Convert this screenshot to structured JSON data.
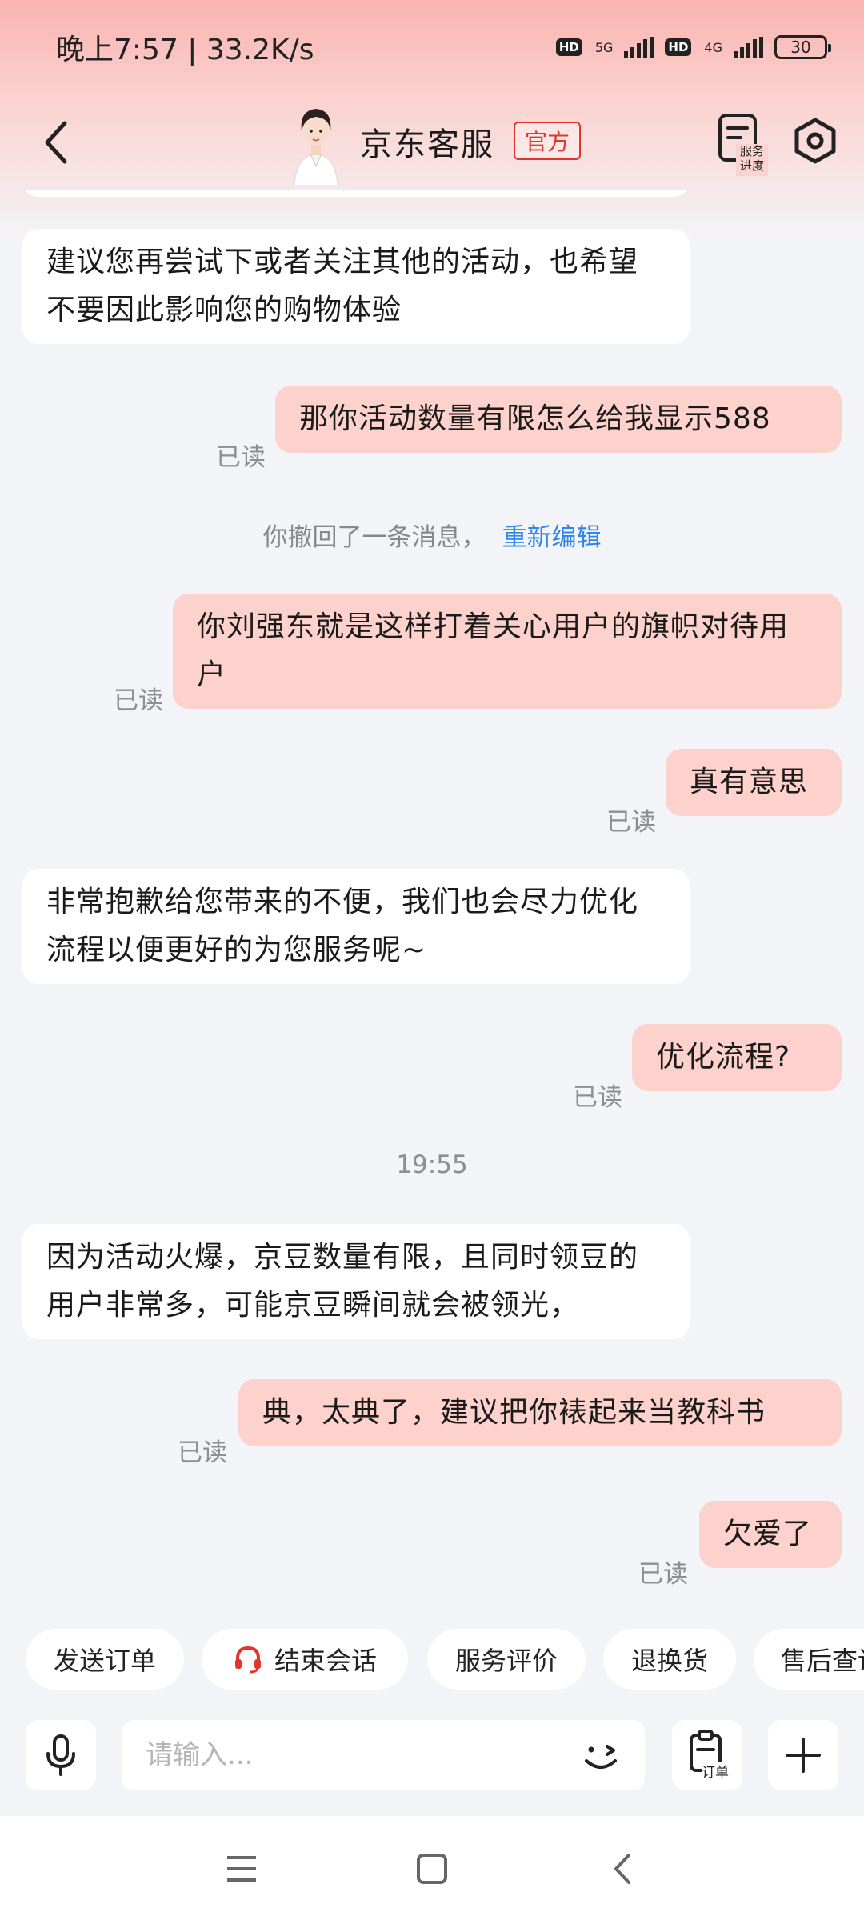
{
  "status_bar": {
    "time_speed": "晚上7:57 | 33.2K/s",
    "hd1": "HD",
    "net1": "5G",
    "hd2": "HD",
    "net2": "4G",
    "battery": "30"
  },
  "header": {
    "title": "京东客服",
    "badge": "官方",
    "service_progress": "服务进度"
  },
  "messages": [
    {
      "side": "left",
      "text": "建议您再尝试下或者关注其他的活动，也希望不要因此影响您的购物体验"
    },
    {
      "side": "right",
      "text": "那你活动数量有限怎么给我显示588",
      "status": "已读"
    },
    {
      "side": "system",
      "text": "你撤回了一条消息，",
      "link": "重新编辑"
    },
    {
      "side": "right",
      "text": "你刘强东就是这样打着关心用户的旗帜对待用户",
      "status": "已读"
    },
    {
      "side": "right",
      "text": "真有意思",
      "status": "已读"
    },
    {
      "side": "left",
      "text": "非常抱歉给您带来的不便，我们也会尽力优化流程以便更好的为您服务呢~"
    },
    {
      "side": "right",
      "text": "优化流程?",
      "status": "已读"
    },
    {
      "side": "time",
      "text": "19:55"
    },
    {
      "side": "left",
      "text": "因为活动火爆，京豆数量有限，且同时领豆的用户非常多，可能京豆瞬间就会被领光，"
    },
    {
      "side": "right",
      "text": "典，太典了，建议把你裱起来当教科书",
      "status": "已读"
    },
    {
      "side": "right",
      "text": "欠爱了",
      "status": "已读"
    }
  ],
  "quick_actions": [
    "发送订单",
    "结束会话",
    "服务评价",
    "退换货",
    "售后查询"
  ],
  "input": {
    "placeholder": "请输入...",
    "order_label": "订单"
  },
  "colors": {
    "accent": "#e0362c",
    "bubble_right": "#fdd1cc",
    "bubble_left": "#ffffff",
    "link": "#2f86e6",
    "background": "#f3f4f8"
  },
  "icons": [
    "back-icon",
    "avatar",
    "service-progress-icon",
    "settings-icon",
    "headset-icon",
    "mic-icon",
    "emoji-icon",
    "order-icon",
    "plus-icon",
    "menu-icon",
    "home-icon",
    "nav-back-icon"
  ]
}
